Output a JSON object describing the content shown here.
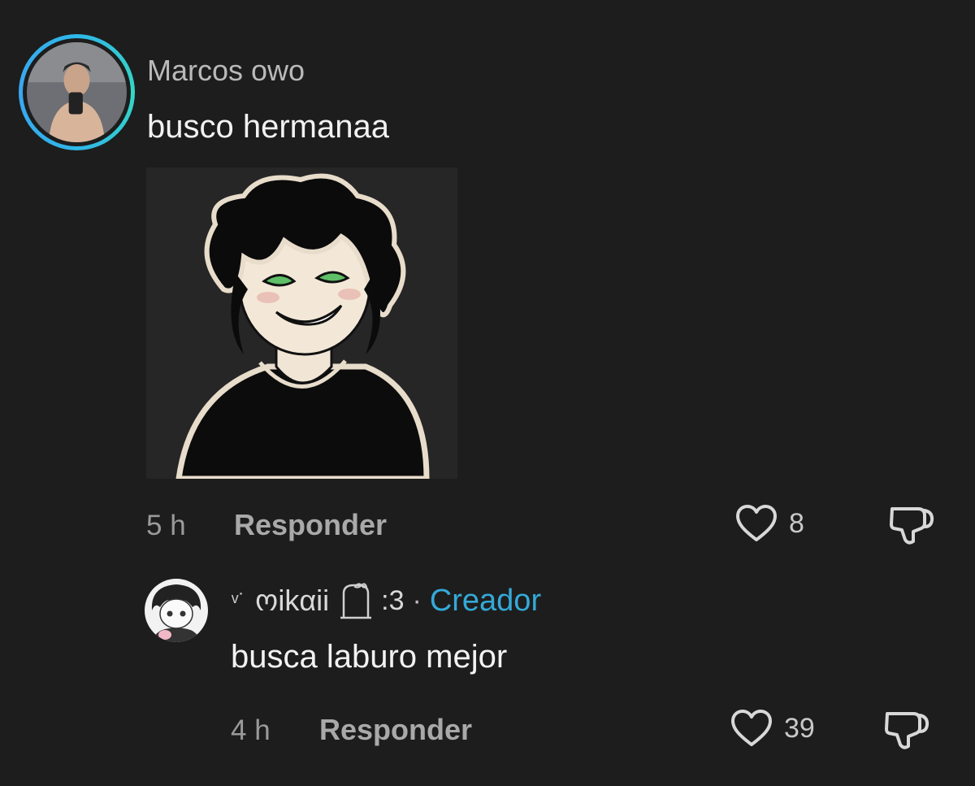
{
  "comments": [
    {
      "username": "Marcos owo",
      "text": "busco hermanaa",
      "time": "5 h",
      "reply_label": "Responder",
      "likes": "8",
      "avatar_icon": "user-avatar-photo",
      "attachment_icon": "anime-character-image"
    },
    {
      "username_prefix": "ᵛ˙",
      "username": "ოikαii",
      "username_suffix": ":3",
      "separator": "·",
      "badge": "Creador",
      "text": "busca laburo mejor",
      "time": "4 h",
      "reply_label": "Responder",
      "likes": "39",
      "avatar_icon": "anime-avatar-drawing"
    }
  ],
  "colors": {
    "background": "#1d1d1d",
    "ring": "#2fb7e8",
    "creator_badge": "#34a9d8"
  }
}
